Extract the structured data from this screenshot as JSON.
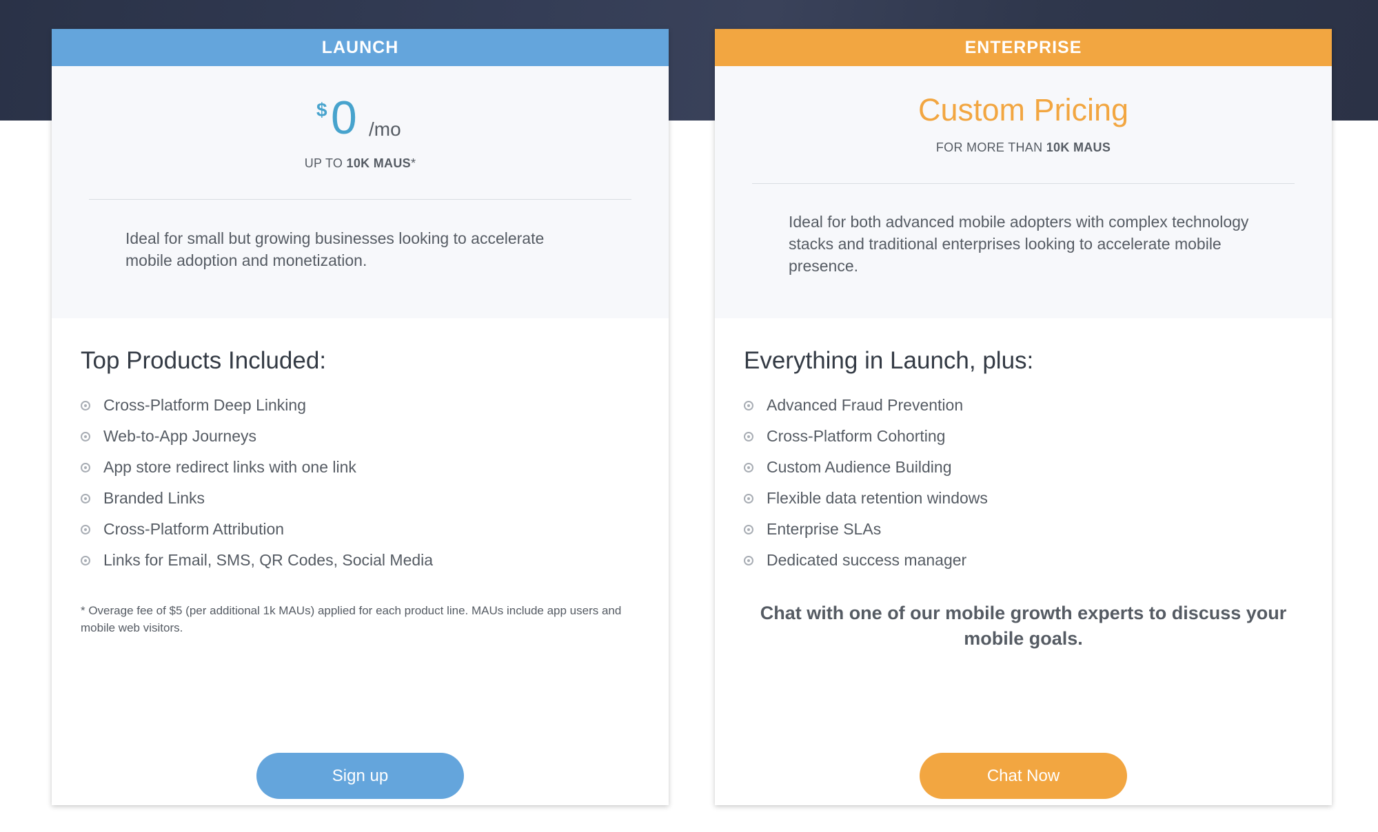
{
  "colors": {
    "launch_accent": "#64a5dc",
    "enterprise_accent": "#f2a641",
    "price_blue": "#47a3cd",
    "hero_background": "#2f374c"
  },
  "launch": {
    "header": "LAUNCH",
    "currency": "$",
    "amount": "0",
    "period": "/mo",
    "sub_prefix": "UP TO",
    "sub_bold": "10K MAUS",
    "sub_suffix": "*",
    "description": "Ideal for small but growing businesses looking to accelerate mobile adoption and monetization.",
    "section_title": "Top Products Included:",
    "features": [
      "Cross-Platform Deep Linking",
      "Web-to-App Journeys",
      "App store redirect links with one link",
      "Branded Links",
      "Cross-Platform Attribution",
      "Links for Email, SMS, QR Codes, Social Media"
    ],
    "footnote": "* Overage fee of $5 (per additional 1k MAUs) applied for each product line. MAUs include app users and mobile web visitors.",
    "button_label": "Sign up"
  },
  "enterprise": {
    "header": "ENTERPRISE",
    "price_label": "Custom Pricing",
    "sub_prefix": "FOR MORE THAN",
    "sub_bold": "10K MAUS",
    "description": "Ideal for both advanced mobile adopters with complex technology stacks and traditional enterprises looking to accelerate mobile presence.",
    "section_title": "Everything in Launch, plus:",
    "features": [
      "Advanced Fraud Prevention",
      "Cross-Platform Cohorting",
      "Custom Audience Building",
      "Flexible data retention windows",
      "Enterprise SLAs",
      "Dedicated success manager"
    ],
    "cta_text": "Chat with one of our mobile growth experts to discuss your mobile goals.",
    "button_label": "Chat Now"
  }
}
